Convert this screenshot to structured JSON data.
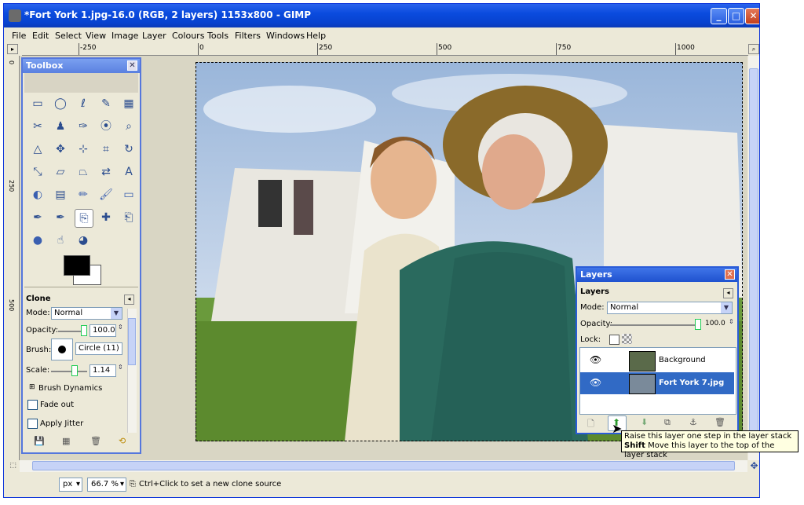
{
  "window": {
    "title": "*Fort York 1.jpg-16.0 (RGB, 2 layers) 1153x800 - GIMP"
  },
  "menu": [
    "File",
    "Edit",
    "Select",
    "View",
    "Image",
    "Layer",
    "Colours",
    "Tools",
    "Filters",
    "Windows",
    "Help"
  ],
  "ruler_h": [
    "-250",
    "0",
    "250",
    "500",
    "750",
    "1000"
  ],
  "ruler_v": [
    "0",
    "250",
    "500"
  ],
  "toolbox": {
    "title": "Toolbox",
    "tools": [
      "rect-select",
      "ellipse-select",
      "free-select",
      "fuzzy-select",
      "by-color-select",
      "scissors",
      "foreground-select",
      "paths",
      "color-picker",
      "zoom",
      "measure",
      "move",
      "align",
      "crop",
      "rotate",
      "scale",
      "shear",
      "perspective",
      "flip",
      "text",
      "bucket-fill",
      "blend",
      "pencil",
      "paintbrush",
      "eraser",
      "airbrush",
      "ink",
      "clone",
      "heal",
      "perspective-clone",
      "blur",
      "smudge",
      "dodge-burn"
    ],
    "options": {
      "title": "Clone",
      "mode_label": "Mode:",
      "mode_value": "Normal",
      "opacity_label": "Opacity:",
      "opacity_value": "100.0",
      "brush_label": "Brush:",
      "brush_value": "Circle (11)",
      "scale_label": "Scale:",
      "scale_value": "1.14",
      "brush_dynamics": "Brush Dynamics",
      "fade_out": "Fade out",
      "apply_jitter": "Apply Jitter"
    }
  },
  "layers": {
    "title": "Layers",
    "heading": "Layers",
    "mode_label": "Mode:",
    "mode_value": "Normal",
    "opacity_label": "Opacity:",
    "opacity_value": "100.0",
    "lock_label": "Lock:",
    "items": [
      {
        "name": "Background",
        "selected": false
      },
      {
        "name": "Fort York 7.jpg",
        "selected": true
      }
    ]
  },
  "tooltip": {
    "line1": "Raise this layer one step in the layer stack",
    "line2_key": "Shift",
    "line2_text": "Move this layer to the top of the layer stack"
  },
  "status": {
    "unit": "px",
    "zoom": "66.7 %",
    "message": "Ctrl+Click to set a new clone source"
  },
  "colors": {
    "titlebar": "#0a4bde",
    "accent": "#3169c6",
    "foreground": "#000000",
    "background": "#ffffff"
  }
}
